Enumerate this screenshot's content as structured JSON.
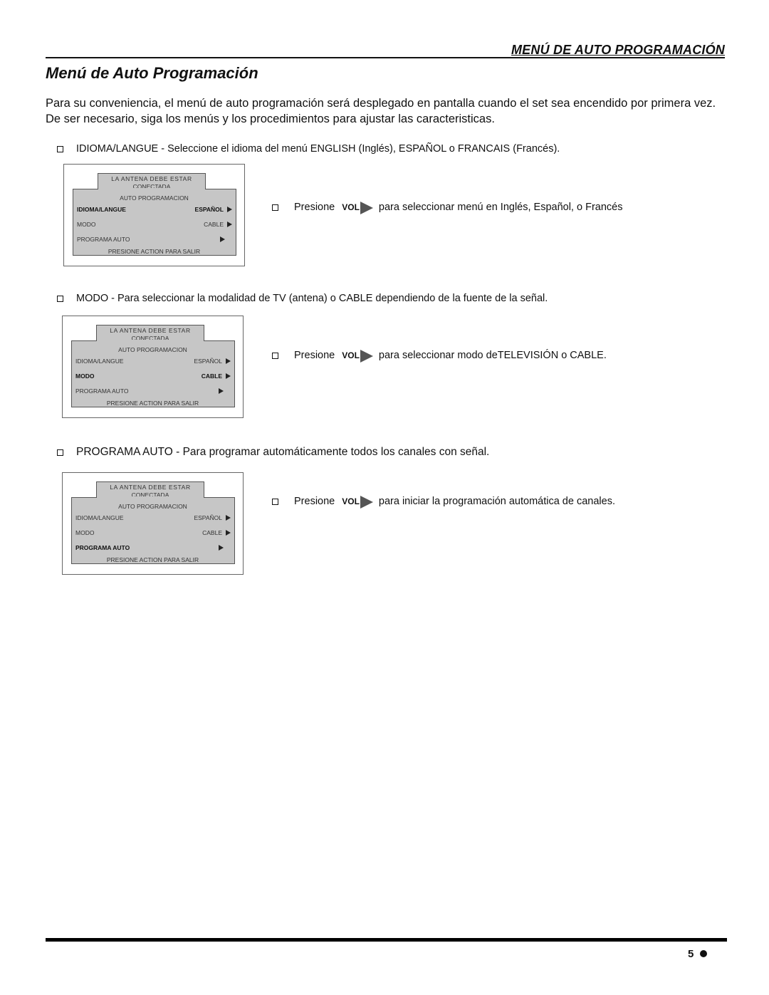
{
  "header": {
    "section_title": "MENÚ DE AUTO PROGRAMACIÓN"
  },
  "page_title": "Menú de Auto Programación",
  "intro": "Para su conveniencia, el menú de auto programación será desplegado en pantalla cuando el set sea encendido por primera vez. De ser necesario, siga los menús y los procedimientos para ajustar las caracteristicas.",
  "sections": [
    {
      "bullet": "IDIOMA/LANGUE - Seleccione el idioma del menú ENGLISH (Inglés), ESPAÑOL o FRANCAIS (Francés).",
      "press_label": "Presione",
      "vol_label": "VOL",
      "press_text": "para seleccionar menú en Inglés, Español, o Francés"
    },
    {
      "bullet": "MODO - Para seleccionar la modalidad de TV (antena) o CABLE dependiendo de la fuente de la señal.",
      "press_label": "Presione",
      "vol_label": "VOL",
      "press_text": "para seleccionar modo deTELEVISIÓN o CABLE."
    },
    {
      "bullet": "PROGRAMA AUTO - Para programar automáticamente todos los canales con señal.",
      "press_label": "Presione",
      "vol_label": "VOL",
      "press_text": "para iniciar la programación automática de canales."
    }
  ],
  "menu": {
    "tab_line1": "LA ANTENA DEBE ESTAR",
    "tab_line2": "CONECTADA",
    "title": "AUTO PROGRAMACION",
    "rows": [
      {
        "label": "IDIOMA/LANGUE",
        "value": "ESPAÑOL"
      },
      {
        "label": "MODO",
        "value": "CABLE"
      },
      {
        "label": "PROGRAMA AUTO",
        "value": ""
      }
    ],
    "footer": "PRESIONE ACTION PARA SALIR",
    "selected_rows_per_screen": [
      0,
      1,
      2
    ]
  },
  "footer": {
    "page_number": "5"
  }
}
